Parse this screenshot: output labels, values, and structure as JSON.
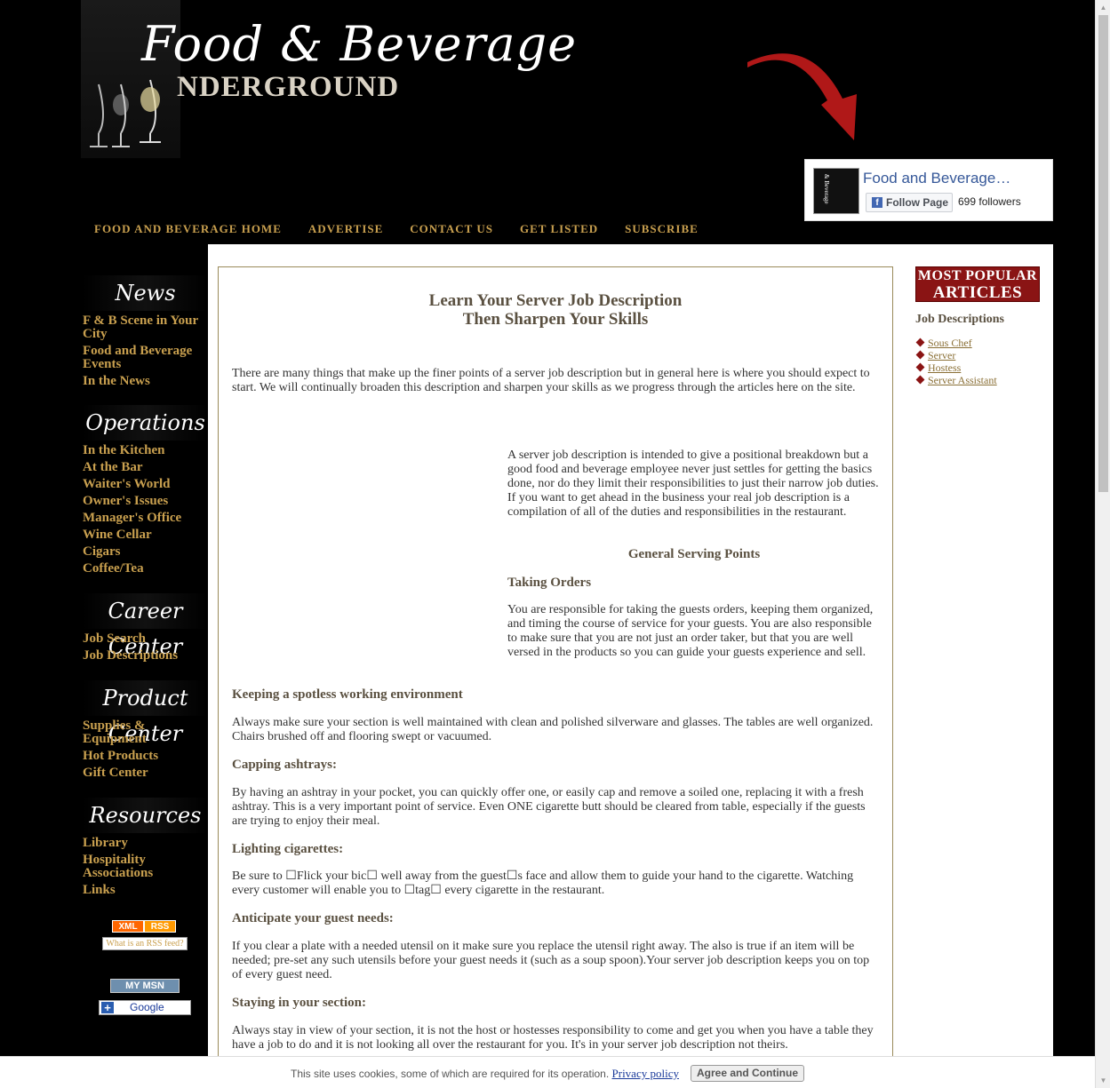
{
  "header": {
    "logo_script": "Food & Beverage",
    "logo_under": "NDERGROUND",
    "arrow_color": "#b01818"
  },
  "facebook": {
    "page_name": "Food and Beverage…",
    "follow_label": "Follow Page",
    "followers": "699 followers"
  },
  "topnav": [
    "FOOD AND BEVERAGE HOME",
    "ADVERTISE",
    "CONTACT US",
    "GET LISTED",
    "SUBSCRIBE"
  ],
  "sidebar": {
    "news_title": "News",
    "news": [
      "F & B Scene in Your City",
      "Food and Beverage Events",
      "In the News"
    ],
    "operations_title": "Operations",
    "operations": [
      "In the Kitchen",
      "At the Bar",
      "Waiter's World",
      "Owner's Issues",
      "Manager's Office",
      "Wine Cellar",
      "Cigars",
      "Coffee/Tea"
    ],
    "career_title": "Career Center",
    "career": [
      "Job Search",
      "Job Descriptions"
    ],
    "product_title": "Product Center",
    "product": [
      "Supplies & Equipment",
      "Hot Products",
      "Gift Center"
    ],
    "resources_title": "Resources",
    "resources": [
      "Library",
      "Hospitality Associations",
      "Links"
    ],
    "rss_xml": "XML",
    "rss_rss": "RSS",
    "rss_what": "What is an RSS feed?",
    "mymsn": "MY MSN",
    "google": "Google"
  },
  "article": {
    "title_line1": "Learn Your Server Job Description",
    "title_line2": "Then Sharpen Your Skills",
    "intro": "There are many things that make up the finer points of a server job description but in general here is where you should expect to start. We will continually broaden this description and sharpen your skills as we progress through the articles here on the site.",
    "right_para": "A server job description is intended to give a positional breakdown but a good food and beverage employee never just settles for getting the basics done, nor do they limit their responsibilities to just their narrow job duties. If you want to get ahead in the business your real job description is a compilation of all of the duties and responsibilities in the restaurant.",
    "general_heading": "General Serving Points",
    "taking_heading": "Taking Orders",
    "taking_para": "You are responsible for taking the guests orders, keeping them organized, and timing the course of service for your guests. You are also responsible to make sure that you are not just an order taker, but that you are well versed in the products so you can guide your guests experience and sell.",
    "h1": "Keeping a spotless working environment",
    "p1": "Always make sure your section is well maintained with clean and polished silverware and glasses. The tables are well organized. Chairs brushed off and flooring swept or vacuumed.",
    "h2": "Capping ashtrays:",
    "p2": "By having an ashtray in your pocket, you can quickly offer one, or easily cap and remove a soiled one, replacing it with a fresh ashtray. This is a very important point of service. Even ONE cigarette butt should be cleared from table, especially if the guests are trying to enjoy their meal.",
    "h3": "Lighting cigarettes:",
    "p3": "Be sure to ☐Flick your bic☐ well away from the guest☐s face and allow them to guide your hand to the cigarette. Watching every customer will enable you to ☐tag☐ every cigarette in the restaurant.",
    "h4": "Anticipate your guest needs:",
    "p4": "If you clear a plate with a needed utensil on it make sure you replace the utensil right away. The also is true if an item will be needed; pre-set any such utensils before your guest needs it (such as a soup spoon).Your server job description keeps you on top of every guest need.",
    "h5": "Staying in your section:",
    "p5": "Always stay in view of your section, it is not the host or hostesses responsibility to come and get you when you have a table they have a job to do and it is not looking all over the restaurant for you. It's in your server job description not theirs."
  },
  "popular": {
    "line1": "MOST POPULAR",
    "line2": "ARTICLES",
    "subhead": "Job Descriptions",
    "links": [
      "Sous Chef",
      "Server",
      "Hostess",
      "Server Assistant"
    ]
  },
  "cookie": {
    "message": "This site uses cookies, some of which are required for its operation.",
    "policy_link": "Privacy policy",
    "button": "Agree and Continue"
  }
}
